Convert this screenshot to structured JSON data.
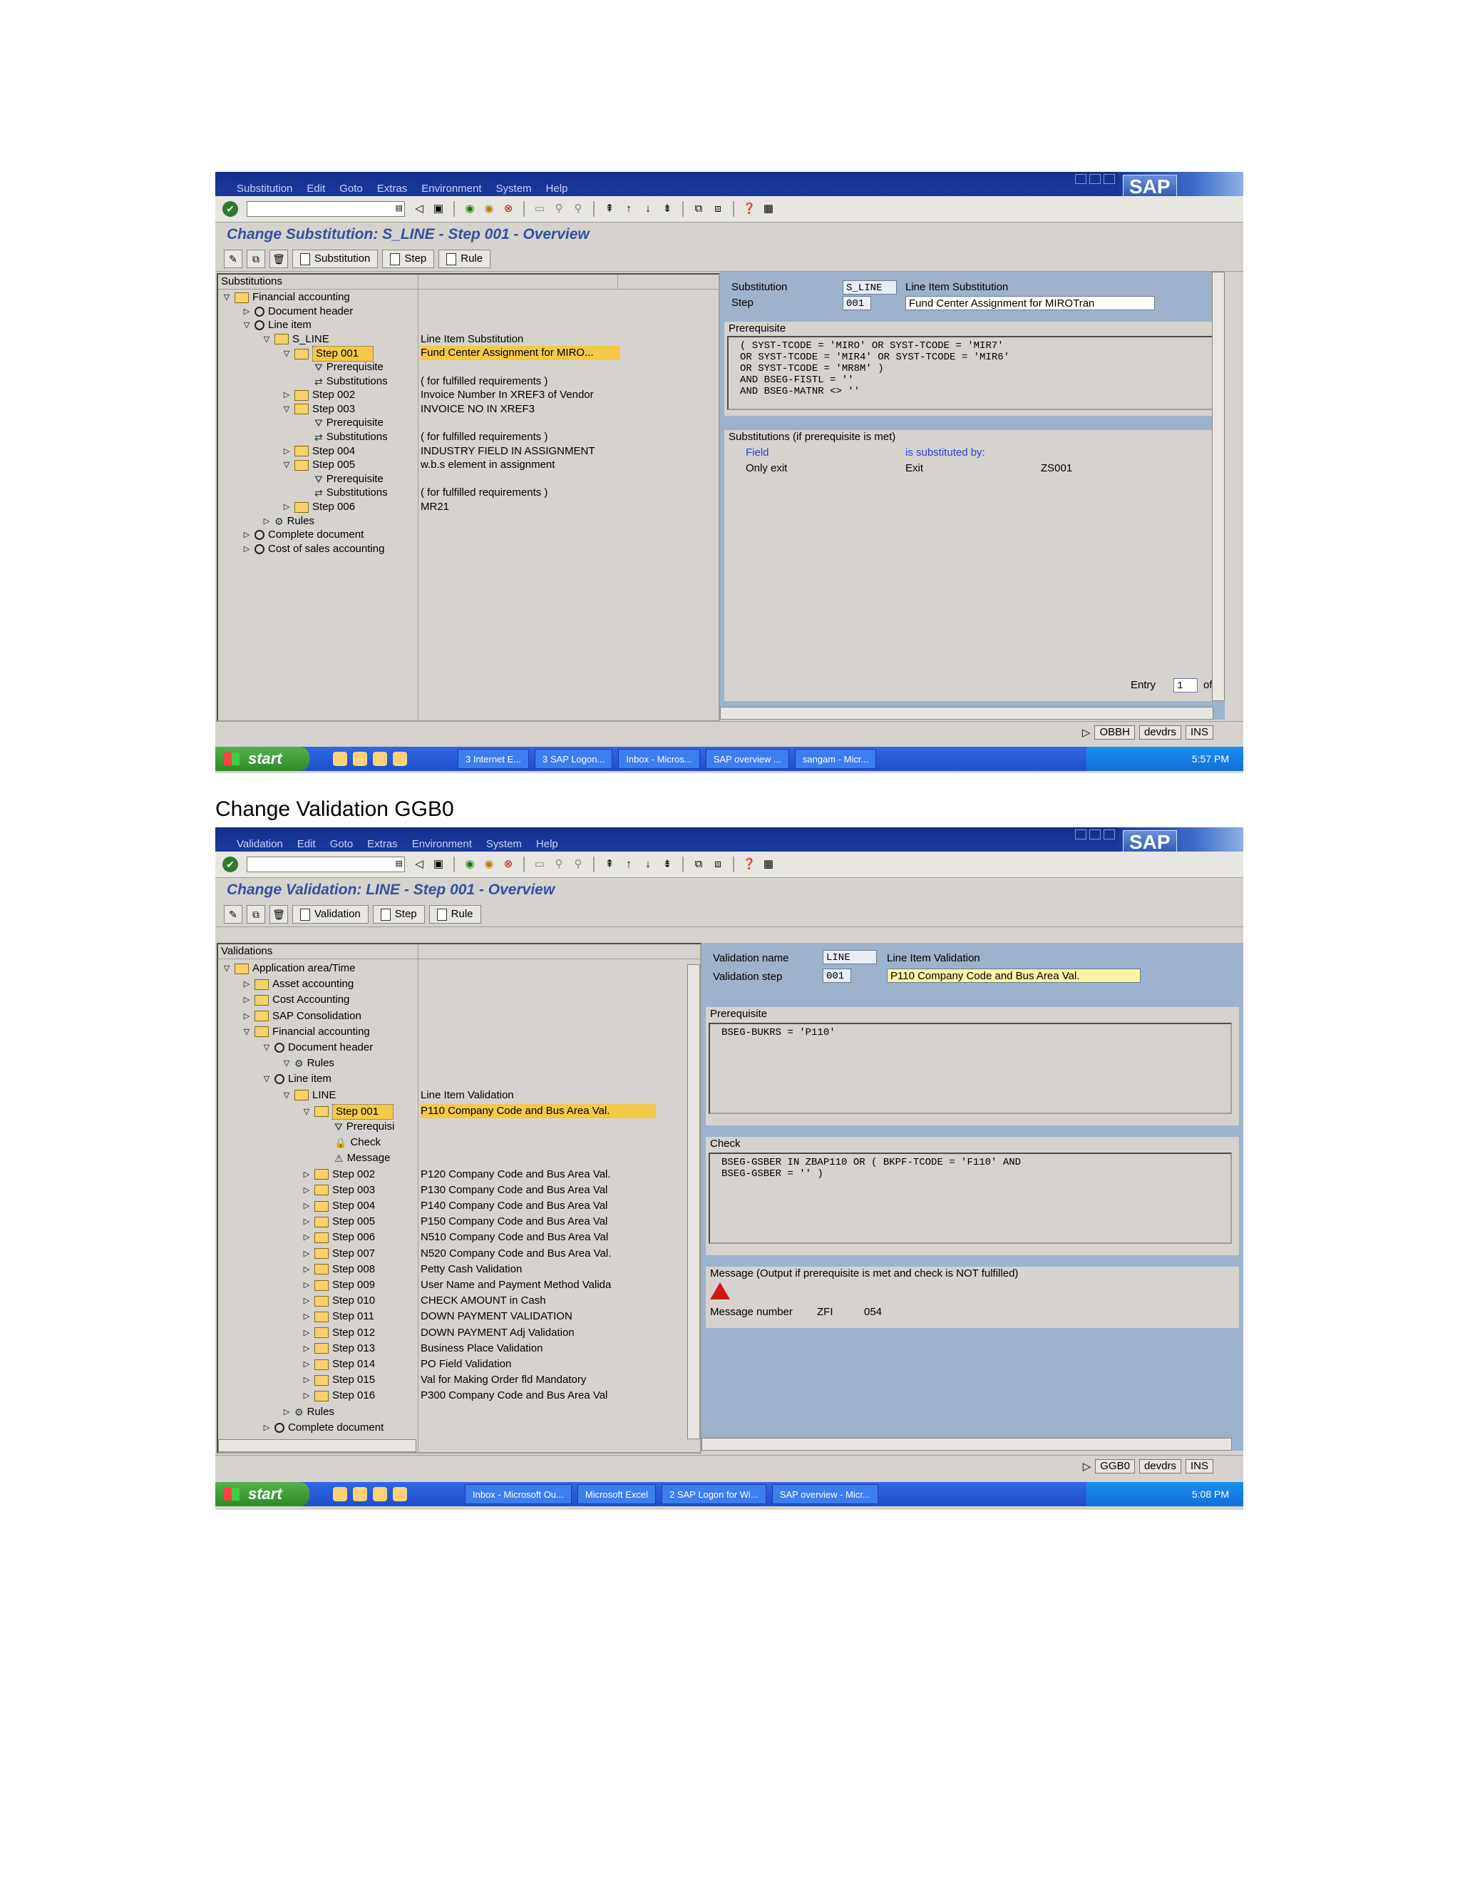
{
  "screen1": {
    "menu": [
      "Substitution",
      "Edit",
      "Goto",
      "Extras",
      "Environment",
      "System",
      "Help"
    ],
    "sap_logo": "SAP",
    "title": "Change Substitution: S_LINE - Step 001 - Overview",
    "app_buttons": [
      "Substitution",
      "Step",
      "Rule"
    ],
    "tree_header": "Substitutions",
    "tree": [
      {
        "level": 0,
        "tri": "▽",
        "icon": "folder",
        "label": "Financial accounting",
        "desc": ""
      },
      {
        "level": 1,
        "tri": "▷",
        "icon": "clock",
        "label": "Document header",
        "desc": ""
      },
      {
        "level": 1,
        "tri": "▽",
        "icon": "clock",
        "label": "Line item",
        "desc": ""
      },
      {
        "level": 2,
        "tri": "▽",
        "icon": "folder",
        "label": "S_LINE",
        "desc": "Line Item Substitution"
      },
      {
        "level": 3,
        "tri": "▽",
        "icon": "folder",
        "label": "Step 001",
        "desc": "Fund Center Assignment for MIRO...",
        "selected": true
      },
      {
        "level": 4,
        "tri": "",
        "icon": "funnel",
        "label": "Prerequisite",
        "desc": ""
      },
      {
        "level": 4,
        "tri": "",
        "icon": "subst",
        "label": "Substitutions",
        "desc": "( for fulfilled requirements )"
      },
      {
        "level": 3,
        "tri": "▷",
        "icon": "folder",
        "label": "Step 002",
        "desc": "Invoice Number In XREF3 of Vendor"
      },
      {
        "level": 3,
        "tri": "▽",
        "icon": "folder",
        "label": "Step 003",
        "desc": "INVOICE NO IN XREF3"
      },
      {
        "level": 4,
        "tri": "",
        "icon": "funnel",
        "label": "Prerequisite",
        "desc": ""
      },
      {
        "level": 4,
        "tri": "",
        "icon": "subst",
        "label": "Substitutions",
        "desc": "( for fulfilled requirements )"
      },
      {
        "level": 3,
        "tri": "▷",
        "icon": "folder",
        "label": "Step 004",
        "desc": "INDUSTRY FIELD IN ASSIGNMENT"
      },
      {
        "level": 3,
        "tri": "▽",
        "icon": "folder",
        "label": "Step 005",
        "desc": "w.b.s element in assignment"
      },
      {
        "level": 4,
        "tri": "",
        "icon": "funnel",
        "label": "Prerequisite",
        "desc": ""
      },
      {
        "level": 4,
        "tri": "",
        "icon": "subst",
        "label": "Substitutions",
        "desc": "( for fulfilled requirements )"
      },
      {
        "level": 3,
        "tri": "▷",
        "icon": "folder",
        "label": "Step 006",
        "desc": "MR21"
      },
      {
        "level": 2,
        "tri": "▷",
        "icon": "rules",
        "label": "Rules",
        "desc": ""
      },
      {
        "level": 1,
        "tri": "▷",
        "icon": "clock",
        "label": "Complete document",
        "desc": ""
      },
      {
        "level": 1,
        "tri": "▷",
        "icon": "clock",
        "label": "Cost of sales accounting",
        "desc": ""
      }
    ],
    "substitution_label": "Substitution",
    "substitution_value": "S_LINE",
    "substitution_desc": "Line Item Substitution",
    "step_label": "Step",
    "step_value": "001",
    "step_desc": "Fund Center Assignment for MIROTran",
    "prereq_caption": "Prerequisite",
    "prereq_code": "( SYST-TCODE = 'MIRO' OR SYST-TCODE = 'MIR7'\nOR SYST-TCODE = 'MIR4' OR SYST-TCODE = 'MIR6'\nOR SYST-TCODE = 'MR8M' )\nAND BSEG-FISTL = ''\nAND BSEG-MATNR <> ''",
    "subs_caption": "Substitutions (if prerequisite is met)",
    "field_header": "Field",
    "subst_header": "is substituted by:",
    "subst_row": [
      "Only exit",
      "Exit",
      "ZS001"
    ],
    "entry_label": "Entry",
    "entry_value": "1",
    "entry_of": "of",
    "status": [
      "OBBH",
      "devdrs",
      "INS"
    ],
    "taskbar": {
      "start": "start",
      "tasks": [
        "3 Internet E...",
        "3 SAP Logon...",
        "Inbox - Micros...",
        "SAP overview ...",
        "sangam - Micr..."
      ],
      "time": "5:57 PM"
    }
  },
  "heading2": "Change Validation GGB0",
  "screen2": {
    "menu": [
      "Validation",
      "Edit",
      "Goto",
      "Extras",
      "Environment",
      "System",
      "Help"
    ],
    "sap_logo": "SAP",
    "title": "Change Validation: LINE - Step 001 - Overview",
    "app_buttons": [
      "Validation",
      "Step",
      "Rule"
    ],
    "tree_header": "Validations",
    "tree": [
      {
        "level": 0,
        "tri": "▽",
        "icon": "folder",
        "label": "Application area/Time",
        "desc": ""
      },
      {
        "level": 1,
        "tri": "▷",
        "icon": "folder",
        "label": "Asset accounting",
        "desc": ""
      },
      {
        "level": 1,
        "tri": "▷",
        "icon": "folder",
        "label": "Cost Accounting",
        "desc": ""
      },
      {
        "level": 1,
        "tri": "▷",
        "icon": "folder",
        "label": "SAP Consolidation",
        "desc": ""
      },
      {
        "level": 1,
        "tri": "▽",
        "icon": "folder",
        "label": "Financial accounting",
        "desc": ""
      },
      {
        "level": 2,
        "tri": "▽",
        "icon": "clock",
        "label": "Document header",
        "desc": ""
      },
      {
        "level": 3,
        "tri": "▽",
        "icon": "rules",
        "label": "Rules",
        "desc": ""
      },
      {
        "level": 2,
        "tri": "▽",
        "icon": "clock",
        "label": "Line item",
        "desc": ""
      },
      {
        "level": 3,
        "tri": "▽",
        "icon": "folder",
        "label": "LINE",
        "desc": "Line Item Validation"
      },
      {
        "level": 4,
        "tri": "▽",
        "icon": "folder",
        "label": "Step 001",
        "desc": "P110 Company Code and Bus Area Val.",
        "selected": true
      },
      {
        "level": 5,
        "tri": "",
        "icon": "funnel",
        "label": "Prerequisi",
        "desc": ""
      },
      {
        "level": 5,
        "tri": "",
        "icon": "check",
        "label": "Check",
        "desc": ""
      },
      {
        "level": 5,
        "tri": "",
        "icon": "msg",
        "label": "Message",
        "desc": ""
      },
      {
        "level": 4,
        "tri": "▷",
        "icon": "folder",
        "label": "Step 002",
        "desc": "P120 Company Code and Bus Area Val."
      },
      {
        "level": 4,
        "tri": "▷",
        "icon": "folder",
        "label": "Step 003",
        "desc": "P130 Company Code and Bus Area Val"
      },
      {
        "level": 4,
        "tri": "▷",
        "icon": "folder",
        "label": "Step 004",
        "desc": "P140 Company Code and Bus Area Val"
      },
      {
        "level": 4,
        "tri": "▷",
        "icon": "folder",
        "label": "Step 005",
        "desc": "P150 Company Code and Bus Area Val"
      },
      {
        "level": 4,
        "tri": "▷",
        "icon": "folder",
        "label": "Step 006",
        "desc": "N510 Company Code and Bus Area Val"
      },
      {
        "level": 4,
        "tri": "▷",
        "icon": "folder",
        "label": "Step 007",
        "desc": "N520 Company Code and Bus Area Val."
      },
      {
        "level": 4,
        "tri": "▷",
        "icon": "folder",
        "label": "Step 008",
        "desc": "Petty Cash Validation"
      },
      {
        "level": 4,
        "tri": "▷",
        "icon": "folder",
        "label": "Step 009",
        "desc": "User Name and Payment Method Valida"
      },
      {
        "level": 4,
        "tri": "▷",
        "icon": "folder",
        "label": "Step 010",
        "desc": "CHECK AMOUNT in Cash"
      },
      {
        "level": 4,
        "tri": "▷",
        "icon": "folder",
        "label": "Step 011",
        "desc": "DOWN PAYMENT VALIDATION"
      },
      {
        "level": 4,
        "tri": "▷",
        "icon": "folder",
        "label": "Step 012",
        "desc": "DOWN PAYMENT Adj Validation"
      },
      {
        "level": 4,
        "tri": "▷",
        "icon": "folder",
        "label": "Step 013",
        "desc": "Business Place Validation"
      },
      {
        "level": 4,
        "tri": "▷",
        "icon": "folder",
        "label": "Step 014",
        "desc": "PO Field Validation"
      },
      {
        "level": 4,
        "tri": "▷",
        "icon": "folder",
        "label": "Step 015",
        "desc": "Val for Making Order fld Mandatory"
      },
      {
        "level": 4,
        "tri": "▷",
        "icon": "folder",
        "label": "Step 016",
        "desc": "P300 Company Code and Bus Area Val"
      },
      {
        "level": 3,
        "tri": "▷",
        "icon": "rules",
        "label": "Rules",
        "desc": ""
      },
      {
        "level": 2,
        "tri": "▷",
        "icon": "clock",
        "label": "Complete document",
        "desc": ""
      }
    ],
    "valname_label": "Validation name",
    "valname_value": "LINE",
    "valname_desc": "Line Item Validation",
    "valstep_label": "Validation step",
    "valstep_value": "001",
    "valstep_desc": "P110 Company Code and Bus Area Val.",
    "prereq_caption": "Prerequisite",
    "prereq_code": "BSEG-BUKRS = 'P110'",
    "check_caption": "Check",
    "check_code": "BSEG-GSBER IN ZBAP110 OR ( BKPF-TCODE = 'F110' AND\nBSEG-GSBER = '' )",
    "message_caption": "Message (Output if prerequisite is met and check is NOT fulfilled)",
    "msgnum_label": "Message number",
    "msgnum_class": "ZFI",
    "msgnum_value": "054",
    "status": [
      "GGB0",
      "devdrs",
      "INS"
    ],
    "taskbar": {
      "start": "start",
      "tasks": [
        "Inbox - Microsoft Ou...",
        "Microsoft Excel",
        "2 SAP Logon for Wi...",
        "SAP overview - Micr..."
      ],
      "time": "5:08 PM"
    }
  }
}
